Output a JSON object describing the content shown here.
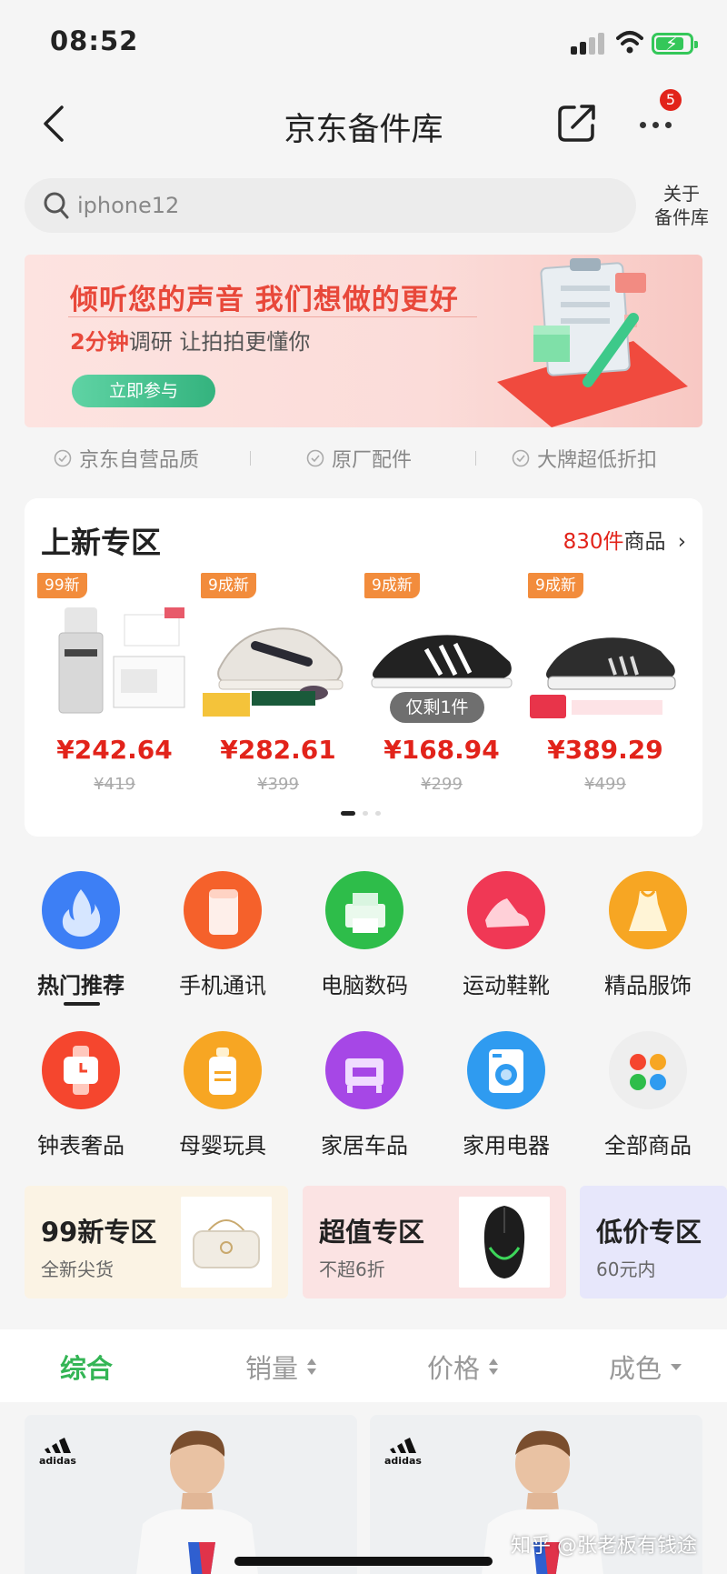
{
  "status_bar": {
    "time": "08:52"
  },
  "nav": {
    "title": "京东备件库",
    "badge_count": "5"
  },
  "search": {
    "value": "iphone12",
    "about_line1": "关于",
    "about_line2": "备件库"
  },
  "banner": {
    "headline": "倾听您的声音 我们想做的更好",
    "sub_bold": "2分钟",
    "sub_rest": "调研 让拍拍更懂你",
    "cta": "立即参与"
  },
  "guarantees": [
    "京东自营品质",
    "原厂配件",
    "大牌超低折扣"
  ],
  "new_zone": {
    "title": "上新专区",
    "count_number": "830件",
    "count_suffix": "商品",
    "products": [
      {
        "tag": "99新",
        "price": "¥242.64",
        "original": "¥419",
        "image": "skincare-serum"
      },
      {
        "tag": "9成新",
        "price": "¥282.61",
        "original": "¥399",
        "image": "white-sneaker"
      },
      {
        "tag": "9成新",
        "price": "¥168.94",
        "original": "¥299",
        "image": "black-sneaker",
        "remaining": "仅剩1件"
      },
      {
        "tag": "9成新",
        "price": "¥389.29",
        "original": "¥499",
        "image": "black-running-shoe"
      }
    ]
  },
  "categories": [
    {
      "label": "热门推荐",
      "icon": "flame-icon",
      "color": "#3d7ff5",
      "active": true
    },
    {
      "label": "手机通讯",
      "icon": "phone-icon",
      "color": "#f5612b"
    },
    {
      "label": "电脑数码",
      "icon": "printer-icon",
      "color": "#2ebd4a"
    },
    {
      "label": "运动鞋靴",
      "icon": "sneaker-icon",
      "color": "#f03855"
    },
    {
      "label": "精品服饰",
      "icon": "dress-icon",
      "color": "#f7a623"
    },
    {
      "label": "钟表奢品",
      "icon": "watch-icon",
      "color": "#f5462e"
    },
    {
      "label": "母婴玩具",
      "icon": "bottle-icon",
      "color": "#f7a623"
    },
    {
      "label": "家居车品",
      "icon": "furniture-icon",
      "color": "#a647e6"
    },
    {
      "label": "家用电器",
      "icon": "washer-icon",
      "color": "#2f9bf0"
    },
    {
      "label": "全部商品",
      "icon": "grid-icon",
      "color": "#eeeeee"
    }
  ],
  "promos": [
    {
      "title": "99新专区",
      "sub": "全新尖货",
      "bg": "#fbf3e4",
      "image": "handbag"
    },
    {
      "title": "超值专区",
      "sub": "不超6折",
      "bg": "#fbe3e3",
      "image": "gaming-mouse"
    },
    {
      "title": "低价专区",
      "sub": "60元内",
      "bg": "#e7e7fb"
    }
  ],
  "sort": {
    "overall": "综合",
    "sales": "销量",
    "price": "价格",
    "condition": "成色"
  },
  "product_cards": [
    {
      "brand": "adidas",
      "image": "model-tshirt"
    },
    {
      "brand": "adidas",
      "image": "model-tshirt"
    }
  ],
  "watermark": "知乎 @张老板有钱途",
  "colors": {
    "jd_red": "#e2231a",
    "accent_green": "#34b555",
    "tag_orange": "#f28c3c"
  }
}
